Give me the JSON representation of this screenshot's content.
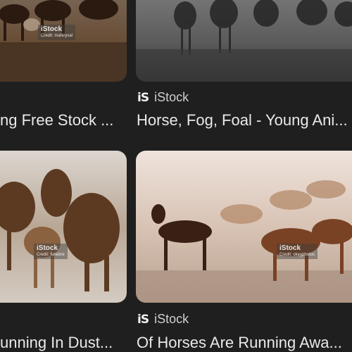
{
  "results": [
    {
      "watermark": "iStock",
      "credit": "Credit: mahirysal",
      "caption": "ng Free Stock ..."
    },
    {
      "source_logo": "iS",
      "source_name": "iStock",
      "caption": "Horse, Fog, Foal - Young Ani..."
    },
    {
      "watermark": "iStock",
      "credit": "Credit: funebre",
      "caption": "unning In Dust..."
    },
    {
      "watermark": "iStock",
      "credit": "Credit: okeyphotos",
      "source_logo": "iS",
      "source_name": "iStock",
      "caption": "Of Horses Are Running Awa..."
    }
  ]
}
